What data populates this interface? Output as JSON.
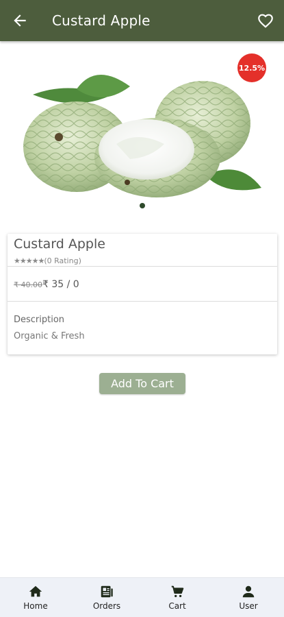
{
  "app_bar": {
    "title": "Custard Apple",
    "back_icon": "arrow-left-icon",
    "favorite_icon": "heart-outline-icon",
    "background_color": "#4d5d3d"
  },
  "hero": {
    "discount_badge": "12.5%",
    "badge_color": "#e4302a",
    "carousel_pages": 1,
    "active_page": 1
  },
  "product": {
    "name": "Custard Apple",
    "stars": "★★★★★",
    "rating_text": "(0 Rating)",
    "old_price": "₹ 40.00",
    "price": "₹ 35 / 0",
    "description_label": "Description",
    "description": "Organic & Fresh"
  },
  "actions": {
    "add_to_cart_label": "Add To Cart",
    "button_color": "#9caf92"
  },
  "bottom_nav": {
    "items": [
      {
        "label": "Home",
        "icon": "home-icon"
      },
      {
        "label": "Orders",
        "icon": "orders-icon"
      },
      {
        "label": "Cart",
        "icon": "cart-icon"
      },
      {
        "label": "User",
        "icon": "user-icon"
      }
    ]
  }
}
